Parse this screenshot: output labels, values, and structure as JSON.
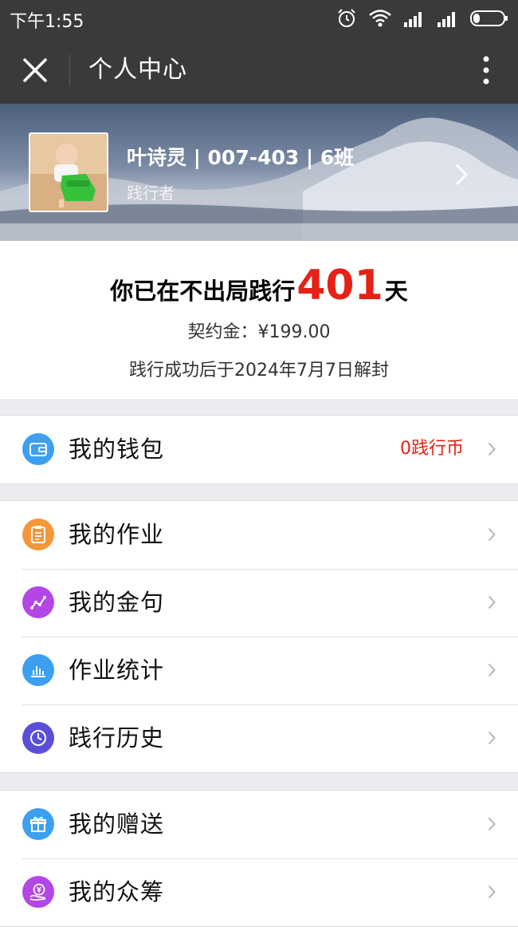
{
  "status_bar": {
    "time": "下午1:55",
    "icons": [
      "alarm-icon",
      "wifi-icon",
      "signal-icon",
      "signal-icon",
      "battery-icon"
    ]
  },
  "header": {
    "title": "个人中心",
    "close_icon": "close-icon",
    "more_icon": "more-vertical-icon"
  },
  "profile": {
    "name": "叶诗灵 | 007-403 | 6班",
    "role": "践行者"
  },
  "stats": {
    "streak_prefix": "你已在不出局践行",
    "streak_days": "401",
    "streak_suffix": "天",
    "deposit": "契约金：¥199.00",
    "unlock": "践行成功后于2024年7月7日解封"
  },
  "menu": {
    "wallet": {
      "label": "我的钱包",
      "value": "0践行币",
      "icon": "wallet-icon",
      "color": "#3d9ff0"
    },
    "homework": {
      "label": "我的作业",
      "icon": "clipboard-icon",
      "color": "#f4973a"
    },
    "quotes": {
      "label": "我的金句",
      "icon": "trend-icon",
      "color": "#b346e5"
    },
    "stats": {
      "label": "作业统计",
      "icon": "bar-chart-icon",
      "color": "#3d9ff0"
    },
    "history": {
      "label": "践行历史",
      "icon": "clock-icon",
      "color": "#5b4fd8"
    },
    "gifts": {
      "label": "我的赠送",
      "icon": "gift-icon",
      "color": "#3d9ff0"
    },
    "crowdfunding": {
      "label": "我的众筹",
      "icon": "yuan-hand-icon",
      "color": "#b346e5"
    }
  },
  "colors": {
    "accent_red": "#e62117",
    "header_bg": "#3a3a3a",
    "page_bg": "#ececf0"
  }
}
